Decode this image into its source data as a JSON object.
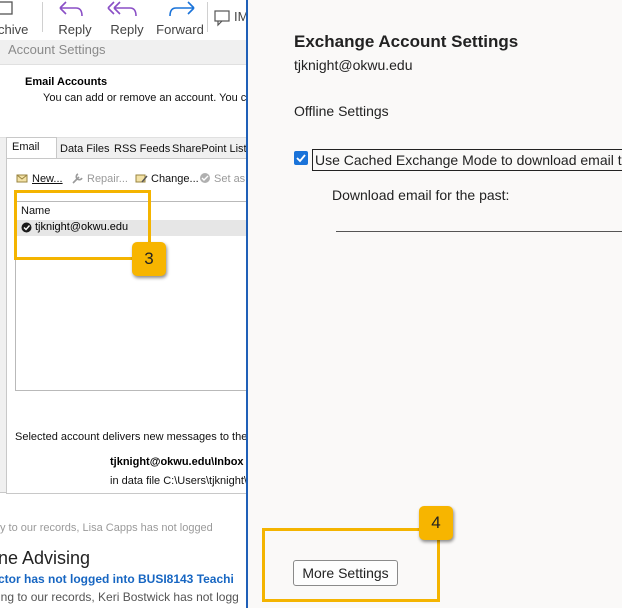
{
  "ribbon": {
    "archive_label": "rchive",
    "reply_label": "Reply",
    "reply_all_label": "Reply",
    "forward_label": "Forward",
    "im_label": "IM"
  },
  "dialog": {
    "title": "Account Settings",
    "email_accounts_title": "Email Accounts",
    "email_accounts_desc": "You can add or remove an account. You can",
    "tabs": [
      "Email",
      "Data Files",
      "RSS Feeds",
      "SharePoint Lists"
    ],
    "toolbar": {
      "new": "New...",
      "repair": "Repair...",
      "change": "Change...",
      "set_as": "Set as"
    },
    "list_header": "Name",
    "accounts": [
      {
        "email": "tjknight@okwu.edu"
      }
    ],
    "deliver_text": "Selected account delivers new messages to the fo",
    "inbox_path": "tjknight@okwu.edu\\Inbox",
    "data_file": "in data file C:\\Users\\tjknight\\."
  },
  "mail_preview": {
    "faded_text": "y to our records, Lisa Capps has not logged",
    "subject": "ne Advising",
    "notice": "ctor has not logged into BUSI8143 Teachi",
    "body": "ing to our records, Keri Bostwick has not logg"
  },
  "exchange": {
    "title": "Exchange Account Settings",
    "email": "tjknight@okwu.edu",
    "offline_label": "Offline Settings",
    "cached_mode_label": "Use Cached Exchange Mode to download email t",
    "cached_mode_checked": true,
    "download_label": "Download email for the past:",
    "more_settings_label": "More Settings"
  },
  "annotations": {
    "step_3": "3",
    "step_4": "4"
  },
  "colors": {
    "highlight": "#f4b400",
    "accent": "#1a73d9",
    "divider": "#1f5fb7",
    "link_blue": "#1766c2"
  }
}
